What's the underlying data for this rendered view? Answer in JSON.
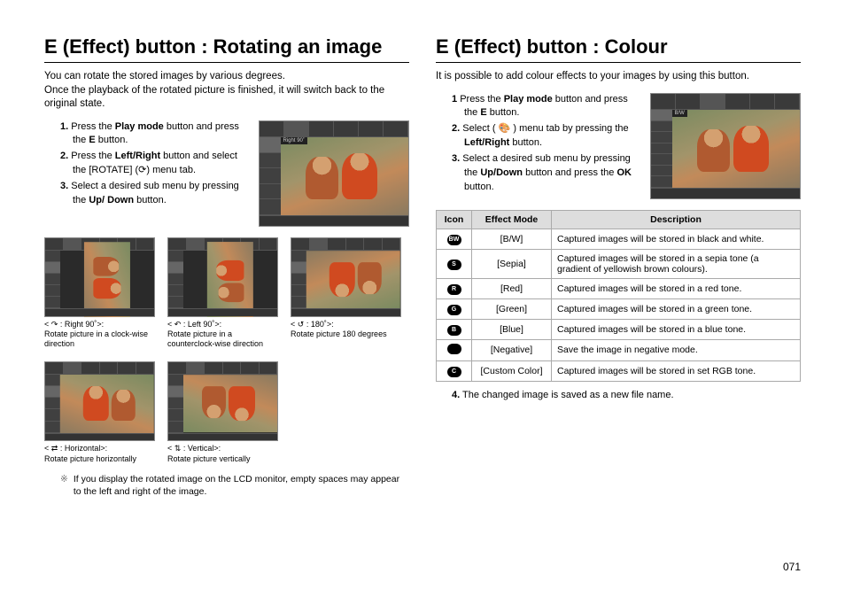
{
  "left": {
    "title": "E (Effect) button : Rotating an image",
    "intro": "You can rotate the stored images by various degrees.\nOnce the playback of the rotated picture is finished, it will switch back to the original state.",
    "steps": [
      {
        "n": "1.",
        "pre": "Press the ",
        "bold": "Play mode",
        "post": " button and press the ",
        "bold2": "E",
        "post2": " button."
      },
      {
        "n": "2.",
        "pre": "Press the ",
        "bold": "Left/Right",
        "post": " button and select the [ROTATE] (",
        "post2": ") menu tab."
      },
      {
        "n": "3.",
        "pre": "Select a desired sub menu by pressing the ",
        "bold": "Up/ Down",
        "post": " button."
      }
    ],
    "big_label": "Right 90˚",
    "thumbs": [
      {
        "glyph": "↷",
        "head": ": Right 90˚>:",
        "cap": "Rotate picture in a clock-wise direction",
        "cls": "photo-r90"
      },
      {
        "glyph": "↶",
        "head": ": Left 90˚>:",
        "cap": "Rotate picture in a counterclock-wise direction",
        "cls": "photo-l90"
      },
      {
        "glyph": "↺",
        "head": ": 180˚>:",
        "cap": "Rotate picture 180 degrees",
        "cls": "photo-180"
      },
      {
        "glyph": "⇄",
        "head": ": Horizontal>:",
        "cap": "Rotate picture horizontally",
        "cls": "photo-h"
      },
      {
        "glyph": "⇅",
        "head": ": Vertical>:",
        "cap": "Rotate picture vertically",
        "cls": "photo-v"
      }
    ],
    "note": "If you display the rotated image on the LCD monitor, empty spaces may appear to the left and right of the image."
  },
  "right": {
    "title": "E (Effect) button : Colour",
    "intro": "It is possible to add colour effects to your images by using this button.",
    "steps": [
      {
        "n": "1",
        "pre": "Press the ",
        "bold": "Play mode",
        "post": " button and press the ",
        "bold2": "E",
        "post2": " button."
      },
      {
        "n": "2.",
        "pre": "Select ( ",
        "post": " ) menu tab by pressing the ",
        "bold": "Left/Right",
        "post2": " button."
      },
      {
        "n": "3.",
        "pre": "Select a desired sub menu by pressing the ",
        "bold": "Up/Down",
        "post": " button and press the ",
        "bold2": "OK",
        "post2": " button."
      }
    ],
    "big_label": "B/W",
    "table": {
      "headers": [
        "Icon",
        "Effect Mode",
        "Description"
      ],
      "rows": [
        {
          "letter": "BW",
          "mode": "[B/W]",
          "desc": "Captured images will be stored in black and white."
        },
        {
          "letter": "S",
          "mode": "[Sepia]",
          "desc": "Captured images will be stored in a sepia tone  (a gradient of yellowish brown colours)."
        },
        {
          "letter": "R",
          "mode": "[Red]",
          "desc": "Captured images will be stored in a red tone."
        },
        {
          "letter": "G",
          "mode": "[Green]",
          "desc": "Captured images will be stored in a green tone."
        },
        {
          "letter": "B",
          "mode": "[Blue]",
          "desc": "Captured images will be stored in a blue tone."
        },
        {
          "letter": "",
          "mode": "[Negative]",
          "desc": "Save the image in negative mode."
        },
        {
          "letter": "C",
          "mode": "[Custom Color]",
          "desc": "Captured images will be stored in set RGB tone."
        }
      ]
    },
    "step4": {
      "n": "4.",
      "text": "The changed image is saved as a new file name."
    }
  },
  "page_number": "071"
}
